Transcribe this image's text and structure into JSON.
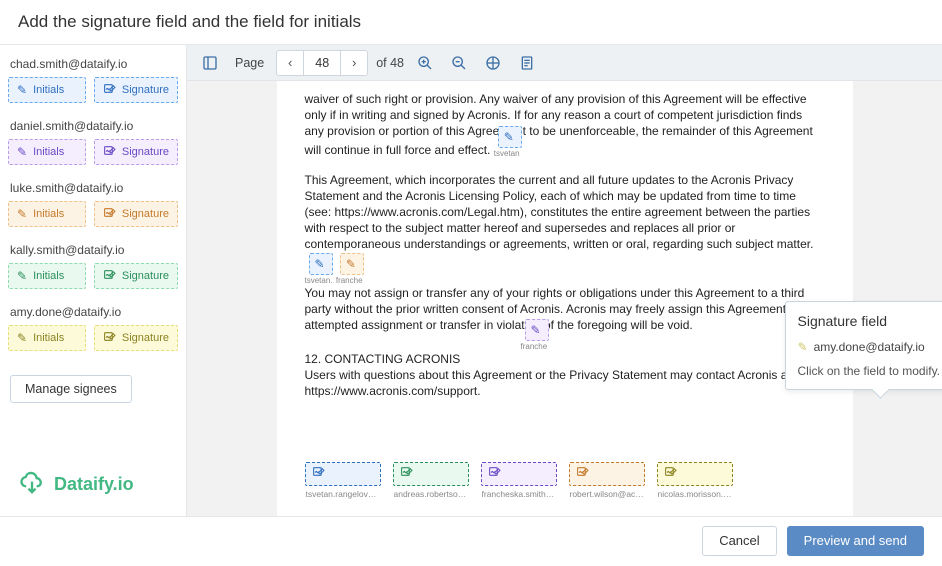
{
  "header": {
    "title": "Add the signature field and the field for initials"
  },
  "sidebar": {
    "signees": [
      {
        "email": "chad.smith@dataify.io",
        "color": "blue",
        "initials_label": "Initials",
        "signature_label": "Signature"
      },
      {
        "email": "daniel.smith@dataify.io",
        "color": "purple",
        "initials_label": "Initials",
        "signature_label": "Signature"
      },
      {
        "email": "luke.smith@dataify.io",
        "color": "orange",
        "initials_label": "Initials",
        "signature_label": "Signature"
      },
      {
        "email": "kally.smith@dataify.io",
        "color": "green",
        "initials_label": "Initials",
        "signature_label": "Signature"
      },
      {
        "email": "amy.done@dataify.io",
        "color": "yellow",
        "initials_label": "Initials",
        "signature_label": "Signature"
      }
    ],
    "manage_label": "Manage signees",
    "brand": "Dataify.io"
  },
  "toolbar": {
    "page_label": "Page",
    "current_page": "48",
    "of_label": "of 48"
  },
  "document": {
    "para1": "waiver of such right or provision. Any waiver of any provision of this Agreement will be effective only if in writing and signed by Acronis. If for any reason a court of competent jurisdiction finds any provision or portion of this Agreement to be unenforceable, the remainder of this Agreement will continue in full force and effect.",
    "marker1_label": "tsvetan",
    "para2": "This Agreement, which incorporates the current and all future updates to the Acronis Privacy Statement and the Acronis Licensing Policy, each of which may be updated from time to time (see: https://www.acronis.com/Legal.htm), constitutes the entire agreement between the parties with respect to the subject matter hereof and supersedes and replaces all prior or contemporaneous understandings or agreements, written or oral, regarding such subject matter.",
    "marker2a_label": "tsvetan.",
    "marker2b_label": "franche",
    "para3": "You may not assign or transfer any of your rights or obligations under this Agreement to a third party without the prior written consent of Acronis. Acronis may freely assign this Agreement. Any attempted assignment or transfer in violation of the foregoing will be void.",
    "marker3_label": "franche",
    "heading": "12. CONTACTING ACRONIS",
    "para4": " Users with questions about this Agreement or the Privacy Statement may contact Acronis at https://www.acronis.com/support.",
    "sig_boxes": [
      {
        "color": "blue",
        "caption": "tsvetan.rangelov@acro"
      },
      {
        "color": "green",
        "caption": "andreas.robertson.wils"
      },
      {
        "color": "purple",
        "caption": "francheska.smith@acr"
      },
      {
        "color": "orange",
        "caption": "robert.wilson@acronis."
      },
      {
        "color": "yellow",
        "caption": "nicolas.morisson.@acr"
      }
    ]
  },
  "tooltip": {
    "title": "Signature field",
    "email": "amy.done@dataify.io",
    "hint": "Click on the field to modify."
  },
  "footer": {
    "cancel": "Cancel",
    "preview": "Preview and send"
  }
}
